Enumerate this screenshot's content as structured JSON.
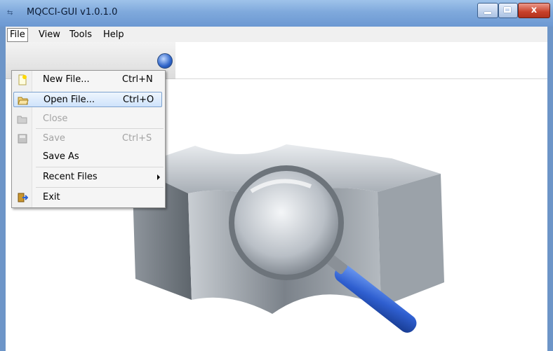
{
  "window": {
    "title": "MQCCI-GUI v1.0.1.0",
    "close_glyph": "x"
  },
  "menubar": {
    "items": [
      "File",
      "View",
      "Tools",
      "Help"
    ]
  },
  "file_menu": {
    "items": [
      {
        "label": "New File...",
        "shortcut": "Ctrl+N",
        "icon": "new-file-icon",
        "enabled": true
      },
      {
        "label": "Open File...",
        "shortcut": "Ctrl+O",
        "icon": "folder-open-icon",
        "enabled": true,
        "highlighted": true
      },
      {
        "label": "Close",
        "shortcut": "",
        "icon": "close-file-icon",
        "enabled": false
      },
      {
        "label": "Save",
        "shortcut": "Ctrl+S",
        "icon": "save-icon",
        "enabled": false
      },
      {
        "label": "Save As",
        "shortcut": "",
        "icon": "",
        "enabled": true
      },
      {
        "label": "Recent Files",
        "shortcut": "",
        "icon": "",
        "enabled": true,
        "submenu": true
      },
      {
        "label": "Exit",
        "shortcut": "",
        "icon": "exit-icon",
        "enabled": true
      }
    ]
  },
  "colors": {
    "titlebar": "#7fa9dc",
    "menu_highlight": "#cfe3fb",
    "magnifier_handle": "#2f5fd0"
  }
}
